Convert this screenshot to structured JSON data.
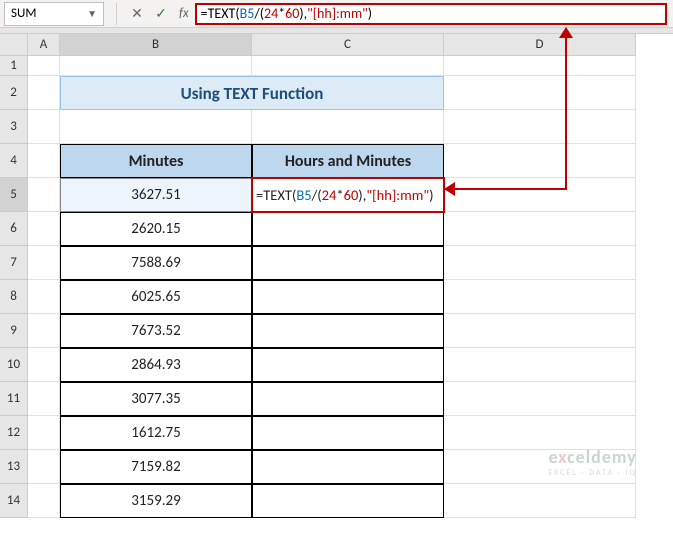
{
  "nameBox": {
    "value": "SUM"
  },
  "formulaBar": {
    "fxLabel": "fx",
    "eq": "=",
    "fn": "TEXT",
    "openP": "(",
    "ref": "B5",
    "div": "/",
    "innerOpen": "(",
    "n1": "24",
    "mult": "*",
    "n2": "60",
    "innerClose": ")",
    "comma": ",",
    "str": "\"[hh]:mm\"",
    "closeP": ")"
  },
  "columns": {
    "a": "A",
    "b": "B",
    "c": "C",
    "d": "D"
  },
  "rows": {
    "r1": "1",
    "r2": "2",
    "r3": "3",
    "r4": "4",
    "r5": "5",
    "r6": "6",
    "r7": "7",
    "r8": "8",
    "r9": "9",
    "r10": "10",
    "r11": "11",
    "r12": "12",
    "r13": "13",
    "r14": "14"
  },
  "title": "Using TEXT Function",
  "headers": {
    "b": "Minutes",
    "c": "Hours and Minutes"
  },
  "data": {
    "b": [
      "3627.51",
      "2620.15",
      "7588.69",
      "6025.65",
      "7673.52",
      "2864.93",
      "3077.35",
      "1612.75",
      "7159.82",
      "3159.29"
    ]
  },
  "cellFormula": {
    "eq": "=",
    "fn": "TEXT",
    "openP": "(",
    "ref": "B5",
    "div": "/",
    "innerOpen": "(",
    "n1": "24",
    "mult": "*",
    "n2": "60",
    "innerClose": ")",
    "comma": ",",
    "str": "\"[hh]:mm\"",
    "closeP": ")"
  },
  "watermark": {
    "e": "e",
    "x": "x",
    "rest": "celdemy",
    "sub": "EXCEL · DATA · IQ"
  }
}
